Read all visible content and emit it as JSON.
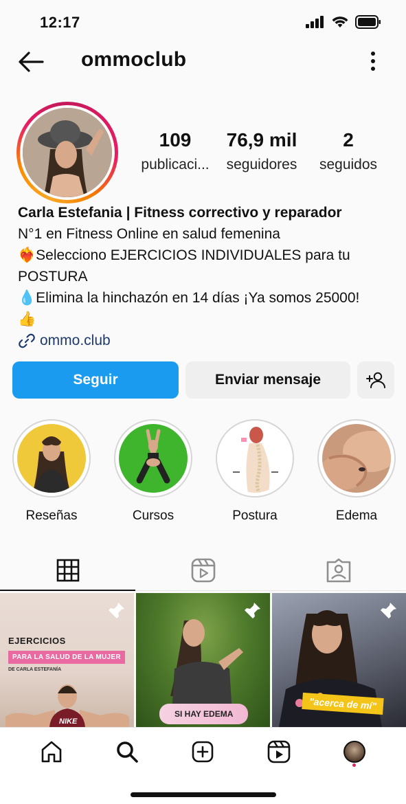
{
  "status_bar": {
    "time": "12:17",
    "icons": [
      "cellular-signal-icon",
      "wifi-icon",
      "battery-icon"
    ]
  },
  "header": {
    "username": "ommoclub",
    "back_icon": "arrow-left-icon",
    "more_icon": "more-vertical-icon"
  },
  "profile": {
    "stats": [
      {
        "value": "109",
        "label": "publicaci..."
      },
      {
        "value": "76,9 mil",
        "label": "seguidores"
      },
      {
        "value": "2",
        "label": "seguidos"
      }
    ],
    "bio": {
      "name": "Carla Estefania | Fitness correctivo y reparador",
      "line1": "N°1 en Fitness Online en salud femenina",
      "line2": "❤️‍🔥Selecciono EJERCICIOS INDIVIDUALES para tu",
      "line3": "POSTURA",
      "line4": "💧Elimina la hinchazón en 14 días ¡Ya somos 25000!",
      "line5": "👍",
      "link": "ommo.club"
    }
  },
  "buttons": {
    "follow": "Seguir",
    "message": "Enviar mensaje",
    "add_user_icon": "add-user-icon"
  },
  "highlights": [
    {
      "label": "Reseñas"
    },
    {
      "label": "Cursos"
    },
    {
      "label": "Postura"
    },
    {
      "label": "Edema"
    }
  ],
  "tabs": [
    "grid-icon",
    "reels-icon",
    "tagged-icon"
  ],
  "posts": [
    {
      "title": "EJERCICIOS",
      "subtitle": "PARA LA SALUD DE LA MUJER",
      "author": "DE CARLA ESTEFANÍA",
      "brand": "NIKE"
    },
    {
      "tag": "SI HAY EDEMA"
    },
    {
      "tag": "\"acerca de mí\""
    }
  ],
  "bottom_nav": [
    "home-icon",
    "search-icon",
    "create-icon",
    "reels-icon",
    "profile-avatar"
  ],
  "colors": {
    "accent": "#1a9bf0",
    "link": "#1e3a6e",
    "notification_dot": "#e0245e"
  }
}
